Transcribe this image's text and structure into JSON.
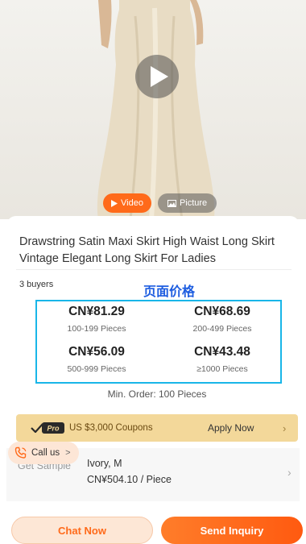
{
  "hero": {
    "video_label": "Video",
    "picture_label": "Picture",
    "icons": [
      "play-icon",
      "video-play-small-icon",
      "picture-icon"
    ]
  },
  "product": {
    "title": "Drawstring Satin Maxi Skirt High Waist Long Skirt Vintage Elegant Long Skirt For Ladies",
    "buyers": "3 buyers"
  },
  "annotation": {
    "label": "页面价格"
  },
  "price_tiers": [
    {
      "price": "CN¥81.29",
      "range": "100-199 Pieces"
    },
    {
      "price": "CN¥68.69",
      "range": "200-499 Pieces"
    },
    {
      "price": "CN¥56.09",
      "range": "500-999 Pieces"
    },
    {
      "price": "CN¥43.48",
      "range": "≥1000 Pieces"
    }
  ],
  "min_order": "Min. Order: 100 Pieces",
  "coupon": {
    "badge": "Pro",
    "text": "US $3,000 Coupons",
    "action": "Apply Now",
    "chevron": "›"
  },
  "sample": {
    "label": "Get Sample",
    "variant": "Ivory, M",
    "price": "CN¥504.10 / Piece",
    "chevron": "›"
  },
  "callus": {
    "label": "Call us",
    "chevron": ">"
  },
  "actions": {
    "chat": "Chat Now",
    "send": "Send Inquiry"
  },
  "colors": {
    "accent": "#ff6a1a",
    "annotation_box": "#19b6e8",
    "annotation_text": "#1d5de0",
    "coupon_bg": "#f3d89a"
  }
}
